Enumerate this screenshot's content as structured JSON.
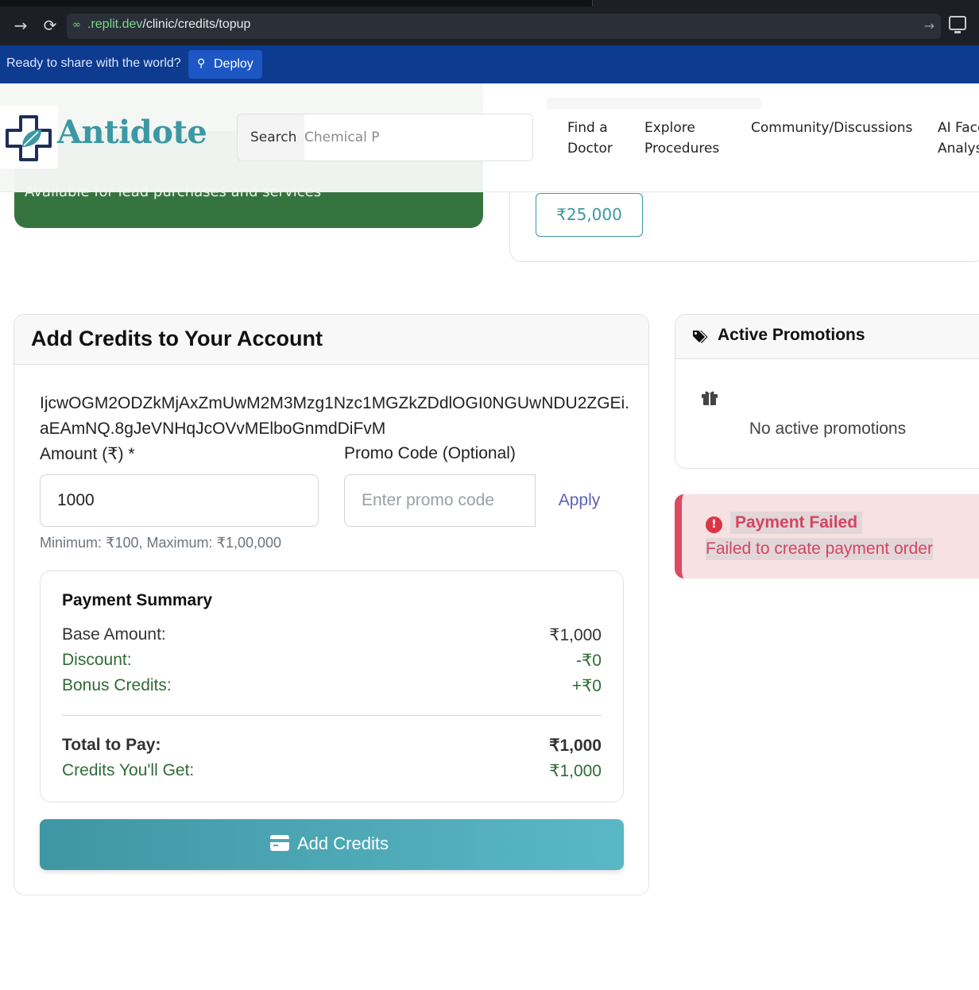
{
  "browser": {
    "url_host": ".replit.dev",
    "url_path": "/clinic/credits/topup",
    "icons": {
      "forward": "arrow-right-icon",
      "reload": "reload-icon",
      "link": "link-icon",
      "go": "arrow-right-icon",
      "device": "monitor-icon"
    }
  },
  "replit_banner": {
    "text": "Ready to share with the world?",
    "deploy_label": "Deploy"
  },
  "header": {
    "logo_text": "Antidote",
    "search_label": "Search",
    "search_placeholder": "Chemical P",
    "nav": [
      {
        "line1": "Find a",
        "line2": "Doctor"
      },
      {
        "line1": "Explore",
        "line2": "Procedures"
      },
      {
        "line1": "Community/Discussions",
        "line2": ""
      },
      {
        "line1": "AI Face",
        "line2": "Analysis"
      }
    ]
  },
  "balance": {
    "subtitle": "Available for lead purchases and services",
    "color": "#36743f"
  },
  "quick_topup": {
    "amount": "₹25,000"
  },
  "add_credits": {
    "title": "Add Credits to Your Account",
    "token": "IjcwOGM2ODZkMjAxZmUwM2M3Mzg1Nzc1MGZkZDdlOGI0NGUwNDU2ZGEi.aEAmNQ.8gJeVNHqJcOVvMElboGnmdDiFvM",
    "amount_label": "Amount (₹) *",
    "amount_value": "1000",
    "promo_label": "Promo Code (Optional)",
    "promo_placeholder": "Enter promo code",
    "apply_label": "Apply",
    "hint": "Minimum: ₹100, Maximum: ₹1,00,000",
    "summary": {
      "title": "Payment Summary",
      "base_label": "Base Amount:",
      "base_value": "₹1,000",
      "discount_label": "Discount:",
      "discount_value": "-₹0",
      "bonus_label": "Bonus Credits:",
      "bonus_value": "+₹0",
      "total_label": "Total to Pay:",
      "total_value": "₹1,000",
      "credits_label": "Credits You'll Get:",
      "credits_value": "₹1,000"
    },
    "submit_label": "Add Credits",
    "submit_icon": "credit-card-icon",
    "accent_color": "#3f96a3"
  },
  "promotions": {
    "title": "Active Promotions",
    "empty_text": "No active promotions",
    "icons": {
      "header": "tags-icon",
      "empty": "gift-icon"
    }
  },
  "alert": {
    "title": "Payment Failed",
    "message": "Failed to create payment order",
    "color": "#dc4a62",
    "icon": "exclamation-circle-icon"
  }
}
